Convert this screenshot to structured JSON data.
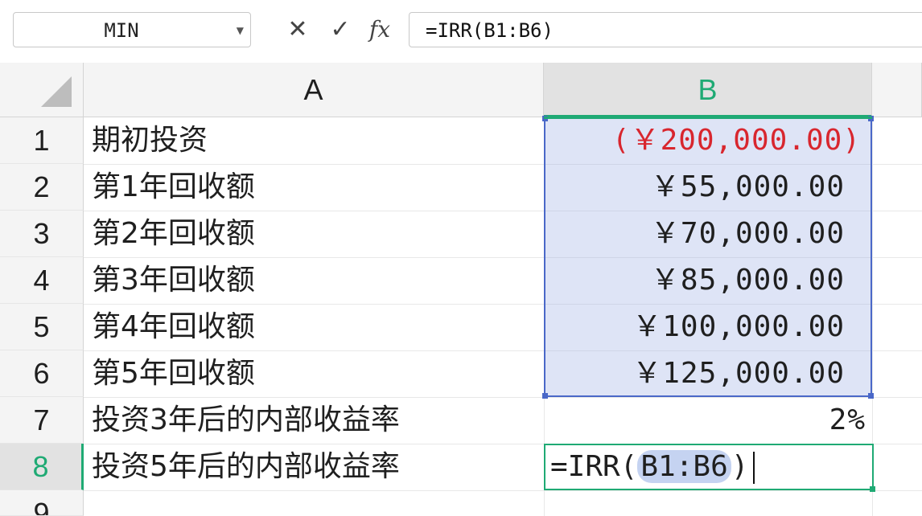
{
  "formula_bar": {
    "name_box": "MIN",
    "cancel_icon": "✕",
    "confirm_icon": "✓",
    "fx_label": "fx",
    "formula": "=IRR(B1:B6)"
  },
  "columns": {
    "a": "A",
    "b": "B"
  },
  "rows": [
    {
      "num": "1",
      "a": "期初投资",
      "b": "(￥200,000.00)"
    },
    {
      "num": "2",
      "a": "第1年回收额",
      "b": "￥55,000.00"
    },
    {
      "num": "3",
      "a": "第2年回收额",
      "b": "￥70,000.00"
    },
    {
      "num": "4",
      "a": "第3年回收额",
      "b": "￥85,000.00"
    },
    {
      "num": "5",
      "a": "第4年回收额",
      "b": "￥100,000.00"
    },
    {
      "num": "6",
      "a": "第5年回收额",
      "b": "￥125,000.00"
    },
    {
      "num": "7",
      "a": "投资3年后的内部收益率",
      "b": "2%"
    },
    {
      "num": "8",
      "a": "投资5年后的内部收益率",
      "b": ""
    },
    {
      "num": "9",
      "a": "",
      "b": ""
    }
  ],
  "editing": {
    "prefix": "=IRR(",
    "ref": "B1:B6",
    "suffix": ")"
  },
  "colors": {
    "accent_green": "#1faa74",
    "selection_blue": "#4a68c8",
    "negative_red": "#d8262e"
  }
}
